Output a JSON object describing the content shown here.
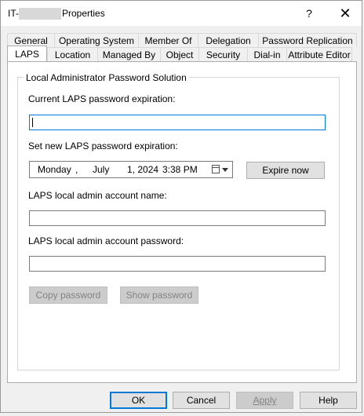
{
  "window": {
    "title_prefix": "IT-",
    "title_suffix": "Properties",
    "help_glyph": "?",
    "close_glyph": "✕"
  },
  "tabs": {
    "row1": [
      "General",
      "Operating System",
      "Member Of",
      "Delegation",
      "Password Replication"
    ],
    "row2": [
      "LAPS",
      "Location",
      "Managed By",
      "Object",
      "Security",
      "Dial-in",
      "Attribute Editor"
    ],
    "active": "LAPS"
  },
  "laps": {
    "group_title": "Local Administrator Password Solution",
    "current_expiration_label": "Current LAPS password expiration:",
    "current_expiration_value": "",
    "new_expiration_label": "Set new LAPS password expiration:",
    "date": {
      "weekday": "Monday",
      "sep1": ",",
      "month": "July",
      "day_year": "1, 2024",
      "time": "3:38 PM"
    },
    "expire_now_button": "Expire now",
    "account_name_label": "LAPS local admin account name:",
    "account_name_value": "",
    "account_password_label": "LAPS local admin account password:",
    "account_password_value": "",
    "copy_password_button": "Copy password",
    "show_password_button": "Show password"
  },
  "footer": {
    "ok": "OK",
    "cancel": "Cancel",
    "apply": "Apply",
    "help": "Help"
  }
}
